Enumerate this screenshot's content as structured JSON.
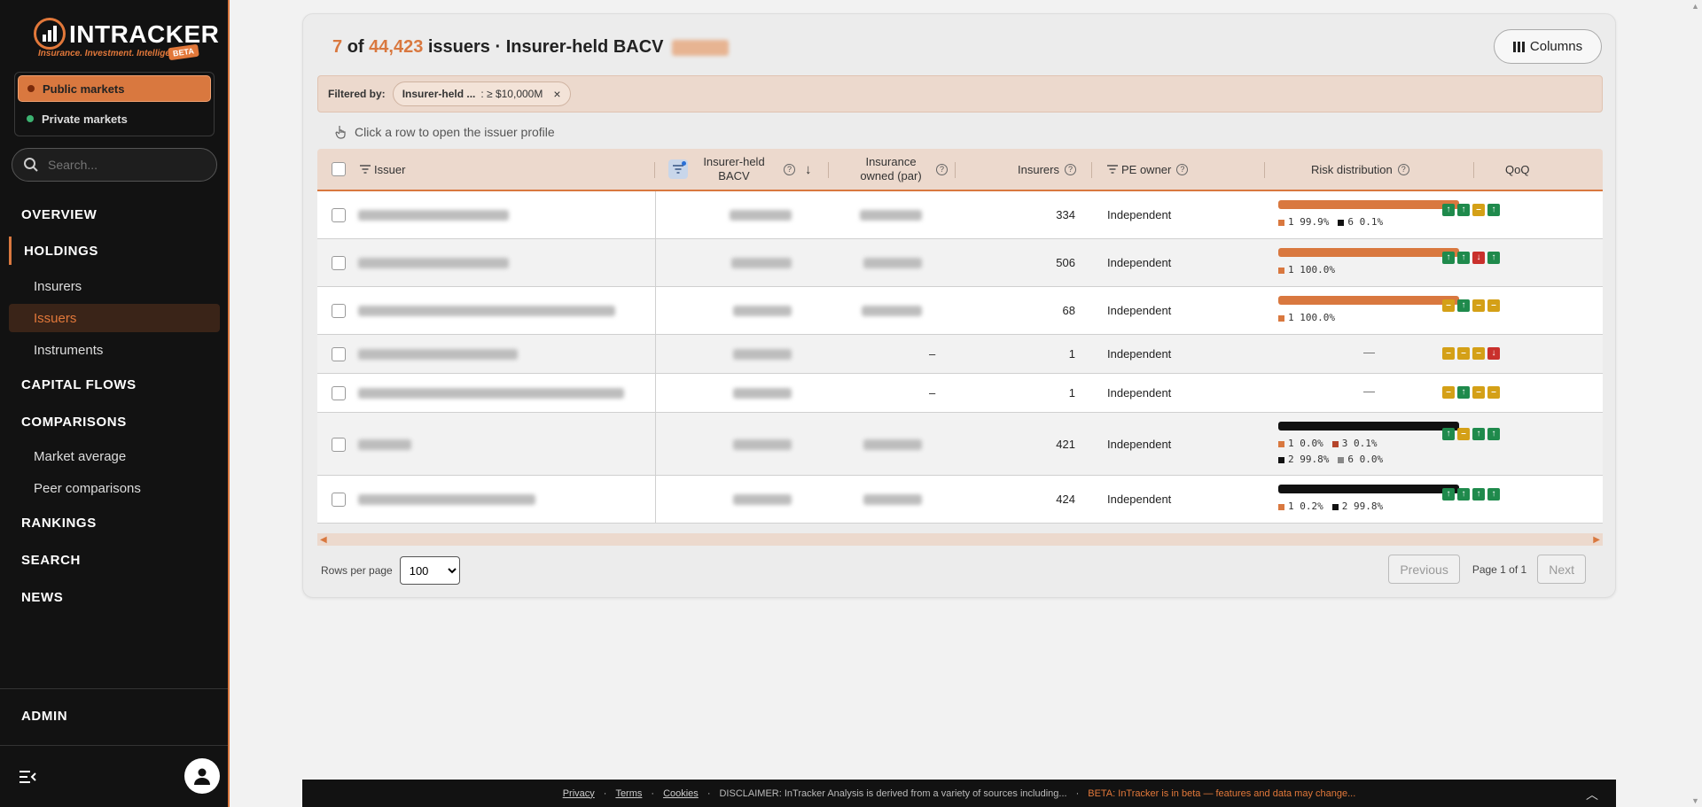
{
  "brand": {
    "name": "INTRACKER",
    "tagline": "Insurance. Investment. Intelligence.",
    "beta": "BETA"
  },
  "markets": [
    {
      "label": "Public markets",
      "dot": "#c0501e",
      "active": true
    },
    {
      "label": "Private markets",
      "dot": "#3cb371",
      "active": false
    }
  ],
  "search": {
    "placeholder": "Search..."
  },
  "nav": {
    "overview": "OVERVIEW",
    "holdings": "HOLDINGS",
    "insurers": "Insurers",
    "issuers": "Issuers",
    "instruments": "Instruments",
    "capital_flows": "CAPITAL FLOWS",
    "comparisons": "COMPARISONS",
    "market_average": "Market average",
    "peer_comparisons": "Peer comparisons",
    "rankings": "RANKINGS",
    "search": "SEARCH",
    "news": "NEWS",
    "admin": "ADMIN"
  },
  "page": {
    "count": "7",
    "of": "of",
    "total": "44,423",
    "title_rest": "issuers · Insurer-held BACV",
    "columns_button": "Columns",
    "filter_label": "Filtered by:",
    "filter_key": "Insurer-held ...",
    "filter_value": ": ≥ $10,000M",
    "filter_remove": "×",
    "hint": "Click a row to open the issuer profile"
  },
  "table": {
    "headers": {
      "issuer": "Issuer",
      "bacv_line1": "Insurer-held",
      "bacv_line2": "BACV",
      "owned_line1": "Insurance",
      "owned_line2": "owned (par)",
      "insurers": "Insurers",
      "pe_owner": "PE owner",
      "risk": "Risk distribution",
      "qoq": "QoQ"
    },
    "rows": [
      {
        "owned": "",
        "insurers": "334",
        "pe": "Independent",
        "risk_bar": "#d9783f",
        "risk_legend": [
          {
            "c": "#d9783f",
            "t": "1 99.9%"
          },
          {
            "c": "#111111",
            "t": "6 0.1%"
          }
        ],
        "qoq": [
          "up",
          "up",
          "flat",
          "up"
        ]
      },
      {
        "owned": "",
        "insurers": "506",
        "pe": "Independent",
        "risk_bar": "#d9783f",
        "risk_legend": [
          {
            "c": "#d9783f",
            "t": "1 100.0%"
          }
        ],
        "qoq": [
          "up",
          "up",
          "down",
          "up"
        ]
      },
      {
        "owned": "",
        "insurers": "68",
        "pe": "Independent",
        "risk_bar": "#d9783f",
        "risk_legend": [
          {
            "c": "#d9783f",
            "t": "1 100.0%"
          }
        ],
        "qoq": [
          "flat",
          "up",
          "flat",
          "flat"
        ]
      },
      {
        "owned": "–",
        "insurers": "1",
        "pe": "Independent",
        "risk_bar": "",
        "risk_legend": [],
        "risk_dash": "—",
        "qoq": [
          "flat",
          "flat",
          "flat",
          "down"
        ]
      },
      {
        "owned": "–",
        "insurers": "1",
        "pe": "Independent",
        "risk_bar": "",
        "risk_legend": [],
        "risk_dash": "—",
        "qoq": [
          "flat",
          "up",
          "flat",
          "flat"
        ]
      },
      {
        "owned": "",
        "insurers": "421",
        "pe": "Independent",
        "risk_bar": "#111111",
        "risk_legend": [
          {
            "c": "#d9783f",
            "t": "1 0.0%"
          },
          {
            "c": "#b5452b",
            "t": "3 0.1%"
          },
          {
            "c": "#111111",
            "t": "2 99.8%"
          },
          {
            "c": "#888888",
            "t": "6 0.0%"
          }
        ],
        "qoq": [
          "up",
          "flat",
          "up",
          "up"
        ]
      },
      {
        "owned": "",
        "insurers": "424",
        "pe": "Independent",
        "risk_bar": "#111111",
        "risk_legend": [
          {
            "c": "#d9783f",
            "t": "1 0.2%"
          },
          {
            "c": "#111111",
            "t": "2 99.8%"
          }
        ],
        "qoq": [
          "up",
          "up",
          "up",
          "up"
        ]
      }
    ]
  },
  "pagination": {
    "rows_per_page_label": "Rows per page",
    "rows_per_page": "100",
    "previous": "Previous",
    "page_info": "Page 1 of 1",
    "next": "Next"
  },
  "footer": {
    "privacy": "Privacy",
    "terms": "Terms",
    "cookies": "Cookies",
    "disclaimer": "DISCLAIMER: InTracker Analysis is derived from a variety of sources including...",
    "beta": "BETA: InTracker is in beta — features and data may change...",
    "sep": "·"
  },
  "colors": {
    "accent": "#d9783f",
    "up": "#1f8a4c",
    "flat": "#d4a017",
    "down": "#c9302c"
  }
}
